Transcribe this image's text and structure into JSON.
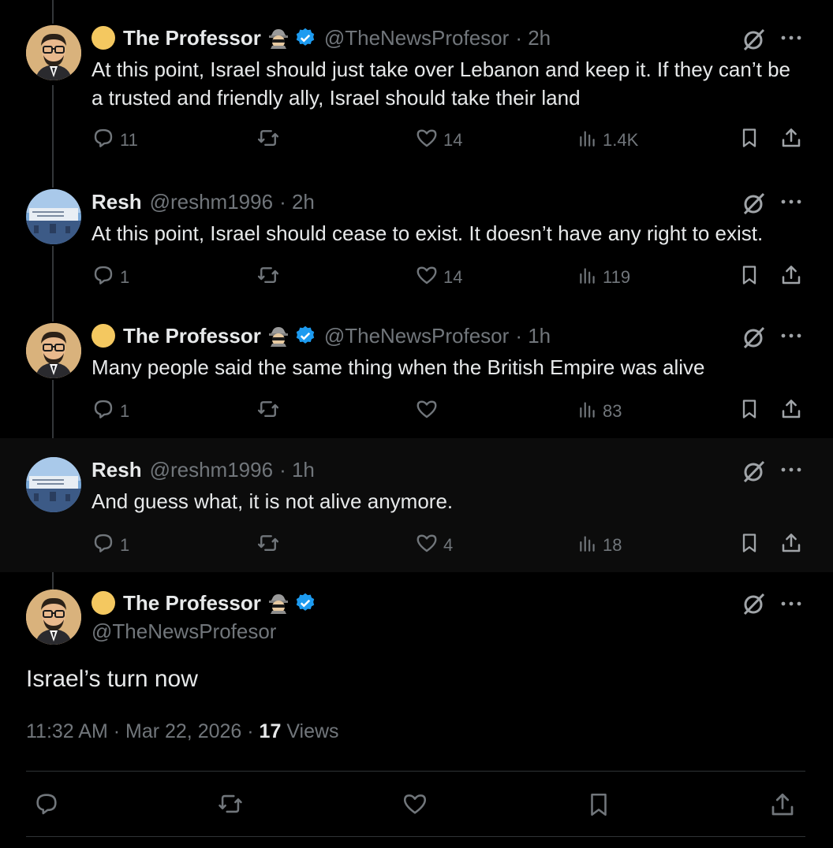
{
  "replies": [
    {
      "name": "The Professor",
      "handle": "@TheNewsProfesor",
      "time": "· 2h",
      "text": "At this point, Israel should just take over Lebanon and keep it. If they can’t be a trusted and friendly ally, Israel should take their land",
      "replies": "11",
      "reposts": "",
      "likes": "14",
      "views": "1.4K"
    },
    {
      "name": "Resh",
      "handle": "@reshm1996",
      "time": "· 2h",
      "text": "At this point, Israel should cease to exist. It doesn’t have any right to exist.",
      "replies": "1",
      "reposts": "",
      "likes": "14",
      "views": "119"
    },
    {
      "name": "The Professor",
      "handle": "@TheNewsProfesor",
      "time": "· 1h",
      "text": "Many people said the same thing when the British Empire was alive",
      "replies": "1",
      "reposts": "",
      "likes": "",
      "views": "83"
    },
    {
      "name": "Resh",
      "handle": "@reshm1996",
      "time": "· 1h",
      "text": "And guess what, it is not alive anymore.",
      "replies": "1",
      "reposts": "",
      "likes": "4",
      "views": "18"
    }
  ],
  "main": {
    "name": "The Professor",
    "handle": "@TheNewsProfesor",
    "text": "Israel’s turn now",
    "time": "11:32 AM",
    "date": "Mar 22, 2026",
    "views_count": "17",
    "views_label": "Views"
  },
  "icons": {
    "reply": "speech-bubble-icon",
    "repost": "repost-arrows-icon",
    "like": "heart-icon",
    "views": "bar-chart-icon",
    "bookmark": "bookmark-icon",
    "share": "share-upload-icon",
    "grok": "grok-slash-icon",
    "more": "more-dots-icon"
  },
  "colors": {
    "background": "#000000",
    "text": "#e7e9ea",
    "muted": "#71767b",
    "verified": "#1d9bf0",
    "emoji": "#f4c860"
  }
}
